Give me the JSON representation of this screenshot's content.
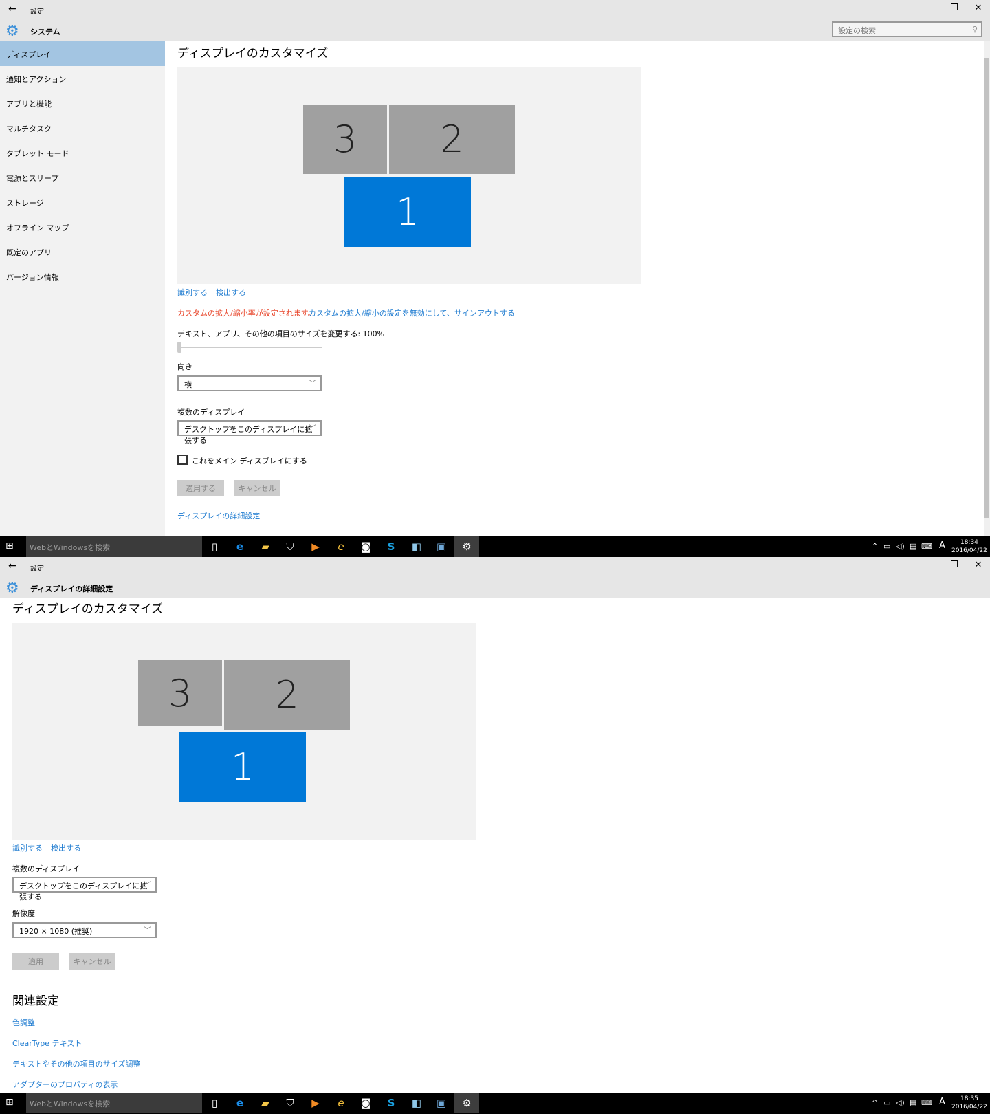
{
  "window1": {
    "title": "設定",
    "header": "システム",
    "search_placeholder": "設定の検索",
    "sidebar": [
      {
        "label": "ディスプレイ",
        "selected": true
      },
      {
        "label": "通知とアクション"
      },
      {
        "label": "アプリと機能"
      },
      {
        "label": "マルチタスク"
      },
      {
        "label": "タブレット モード"
      },
      {
        "label": "電源とスリープ"
      },
      {
        "label": "ストレージ"
      },
      {
        "label": "オフライン マップ"
      },
      {
        "label": "既定のアプリ"
      },
      {
        "label": "バージョン情報"
      }
    ],
    "heading": "ディスプレイのカスタマイズ",
    "monitors": [
      "3",
      "2",
      "1"
    ],
    "identify": "識別する",
    "detect": "検出する",
    "warning": "カスタムの拡大/縮小率が設定されます。",
    "disable_link": "カスタムの拡大/縮小の設定を無効にして、サインアウトする",
    "scale_label": "テキスト、アプリ、その他の項目のサイズを変更する: 100%",
    "scale_value_percent": 100,
    "orientation_label": "向き",
    "orientation_value": "横",
    "multi_label": "複数のディスプレイ",
    "multi_value": "デスクトップをこのディスプレイに拡張する",
    "main_checkbox": "これをメイン ディスプレイにする",
    "main_checked": false,
    "apply": "適用する",
    "cancel": "キャンセル",
    "advanced_link": "ディスプレイの詳細設定"
  },
  "window2": {
    "title": "設定",
    "header": "ディスプレイの詳細設定",
    "heading": "ディスプレイのカスタマイズ",
    "monitors": [
      "3",
      "2",
      "1"
    ],
    "identify": "識別する",
    "detect": "検出する",
    "multi_label": "複数のディスプレイ",
    "multi_value": "デスクトップをこのディスプレイに拡張する",
    "resolution_label": "解像度",
    "resolution_value": "1920 × 1080 (推奨)",
    "apply": "適用",
    "cancel": "キャンセル",
    "related_heading": "関連設定",
    "related_links": [
      "色調整",
      "ClearType テキスト",
      "テキストやその他の項目のサイズ調整",
      "アダプターのプロパティの表示"
    ]
  },
  "taskbar1": {
    "search": "WebとWindowsを検索",
    "time": "18:34",
    "date": "2016/04/22",
    "ime": "A"
  },
  "taskbar2": {
    "search": "WebとWindowsを検索",
    "time": "18:35",
    "date": "2016/04/22",
    "ime": "A"
  },
  "colors": {
    "accent": "#0078d7",
    "link": "#1e7bd0",
    "warning": "#e8462b",
    "sidebar_selected": "#a3c5e2"
  }
}
